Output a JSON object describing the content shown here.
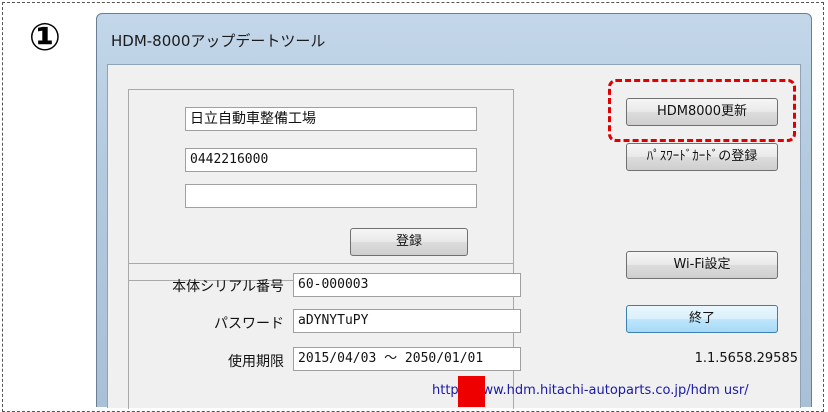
{
  "step_marker": "①",
  "window": {
    "title": "HDM-8000アップデートツール"
  },
  "registration": {
    "shop_name": "日立自動車整備工場",
    "phone": "0442216000",
    "extra": "",
    "register_label": "登録"
  },
  "device": {
    "serial_label": "本体シリアル番号",
    "serial_value": "60-000003",
    "password_label": "パスワード",
    "password_value": "aDYNYTuPY",
    "expiry_label": "使用期限",
    "expiry_value": "2015/04/03 ～ 2050/01/01"
  },
  "buttons": {
    "update_label": "HDM8000更新",
    "password_card_label": "ﾊﾟｽﾜｰﾄﾞｶｰﾄﾞの登録",
    "wifi_label": "Wi-Fi設定",
    "exit_label": "終了"
  },
  "version": "1.1.5658.29585",
  "url": "http://www.hdm.hitachi-autoparts.co.jp/hdm usr/",
  "colors": {
    "highlight": "#e00000",
    "redaction": "#ee0000"
  }
}
